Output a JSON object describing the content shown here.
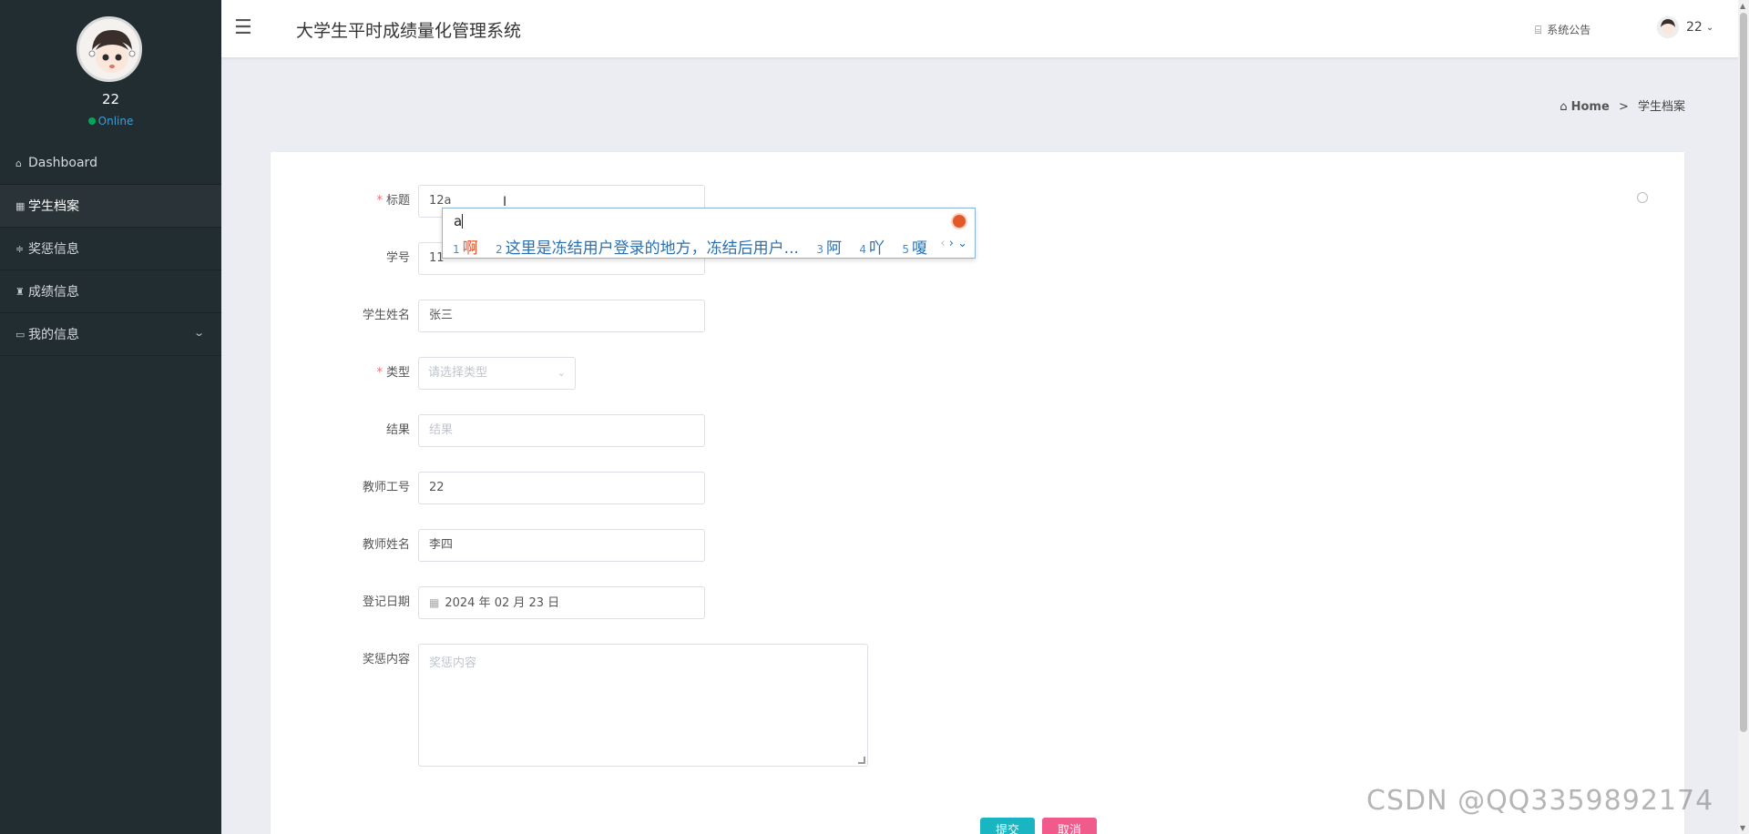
{
  "sidebar": {
    "username": "22",
    "status": "Online",
    "menu": [
      {
        "icon": "home-icon",
        "glyph": "⌂",
        "label": "Dashboard"
      },
      {
        "icon": "grid-icon",
        "glyph": "▦",
        "label": "学生档案"
      },
      {
        "icon": "sliders-icon",
        "glyph": "≑",
        "label": "奖惩信息"
      },
      {
        "icon": "trophy-icon",
        "glyph": "♜",
        "label": "成绩信息"
      },
      {
        "icon": "card-icon",
        "glyph": "▭",
        "label": "我的信息"
      }
    ]
  },
  "header": {
    "title": "大学生平时成绩量化管理系统",
    "notice_label": "系统公告",
    "user": "22"
  },
  "breadcrumb": {
    "home": "Home",
    "separator": ">",
    "current": "学生档案"
  },
  "form": {
    "title_label": "标题",
    "title_value": "12a",
    "student_no_label": "学号",
    "student_no_value": "11",
    "student_name_label": "学生姓名",
    "student_name_value": "张三",
    "type_label": "类型",
    "type_placeholder": "请选择类型",
    "result_label": "结果",
    "result_placeholder": "结果",
    "teacher_no_label": "教师工号",
    "teacher_no_value": "22",
    "teacher_name_label": "教师姓名",
    "teacher_name_value": "李四",
    "date_label": "登记日期",
    "date_value": "2024 年 02 月 23 日",
    "content_label": "奖惩内容",
    "content_placeholder": "奖惩内容",
    "submit": "提交",
    "cancel": "取消"
  },
  "ime": {
    "composition": "a",
    "candidates": [
      {
        "n": "1",
        "text": "啊"
      },
      {
        "n": "2",
        "text": "这里是冻结用户登录的地方，冻结后用户..."
      },
      {
        "n": "3",
        "text": "阿"
      },
      {
        "n": "4",
        "text": "吖"
      },
      {
        "n": "5",
        "text": "嗄"
      }
    ]
  },
  "watermark": "CSDN @QQ3359892174",
  "colors": {
    "sidebar": "#222d32",
    "submit": "#1ab5c3",
    "cancel": "#f05b8c",
    "required": "#f56c6c"
  }
}
